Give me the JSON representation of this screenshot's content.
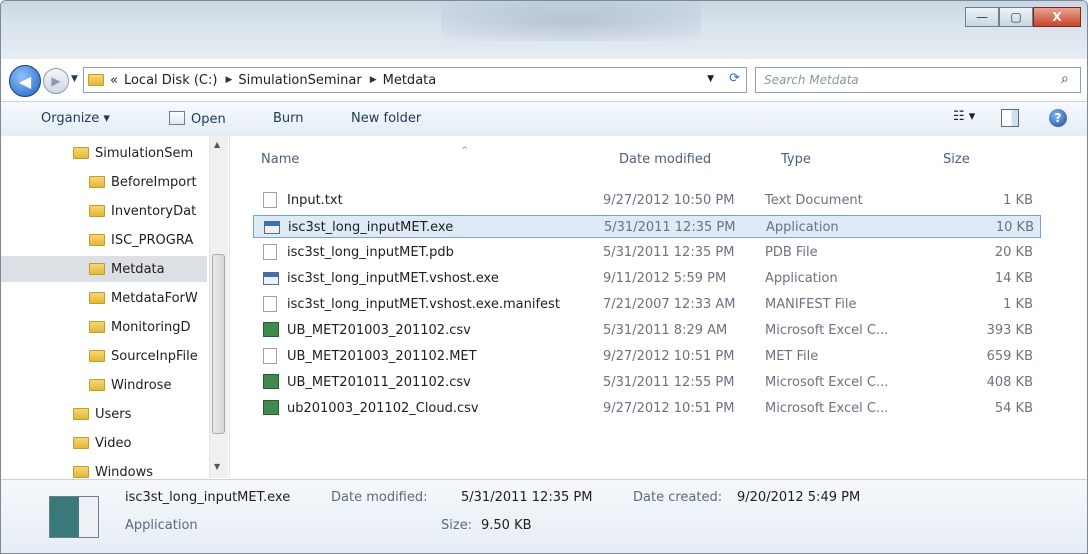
{
  "window": {
    "minimize_label": "—",
    "maximize_label": "▢",
    "close_label": "X"
  },
  "nav": {
    "back_label": "◀",
    "forward_label": "▶",
    "address_prefix": "«",
    "crumbs": [
      "Local Disk (C:)",
      "SimulationSeminar",
      "Metdata"
    ],
    "crumb_sep": "▶",
    "search_placeholder": "Search Metdata"
  },
  "toolbar": {
    "organize": "Organize ▾",
    "open": "Open",
    "burn": "Burn",
    "new_folder": "New folder"
  },
  "tree": {
    "items": [
      {
        "label": "SimulationSem",
        "indent": 0
      },
      {
        "label": "BeforeImport",
        "indent": 1
      },
      {
        "label": "InventoryDat",
        "indent": 1
      },
      {
        "label": "ISC_PROGRA",
        "indent": 1
      },
      {
        "label": "Metdata",
        "indent": 1,
        "selected": true
      },
      {
        "label": "MetdataForW",
        "indent": 1
      },
      {
        "label": "MonitoringD",
        "indent": 1
      },
      {
        "label": "SourceInpFile",
        "indent": 1
      },
      {
        "label": "Windrose",
        "indent": 1
      },
      {
        "label": "Users",
        "indent": 0
      },
      {
        "label": "Video",
        "indent": 0
      },
      {
        "label": "Windows",
        "indent": 0
      }
    ]
  },
  "columns": {
    "name": "Name",
    "date": "Date modified",
    "type": "Type",
    "size": "Size"
  },
  "files": [
    {
      "name": "Input.txt",
      "date": "9/27/2012 10:50 PM",
      "type": "Text Document",
      "size": "1 KB",
      "icon": "txt"
    },
    {
      "name": "isc3st_long_inputMET.exe",
      "date": "5/31/2011 12:35 PM",
      "type": "Application",
      "size": "10 KB",
      "icon": "exe",
      "selected": true
    },
    {
      "name": "isc3st_long_inputMET.pdb",
      "date": "5/31/2011 12:35 PM",
      "type": "PDB File",
      "size": "20 KB",
      "icon": "txt"
    },
    {
      "name": "isc3st_long_inputMET.vshost.exe",
      "date": "9/11/2012 5:59 PM",
      "type": "Application",
      "size": "14 KB",
      "icon": "exe"
    },
    {
      "name": "isc3st_long_inputMET.vshost.exe.manifest",
      "date": "7/21/2007 12:33 AM",
      "type": "MANIFEST File",
      "size": "1 KB",
      "icon": "txt"
    },
    {
      "name": "UB_MET201003_201102.csv",
      "date": "5/31/2011 8:29 AM",
      "type": "Microsoft Excel C...",
      "size": "393 KB",
      "icon": "xls"
    },
    {
      "name": "UB_MET201003_201102.MET",
      "date": "9/27/2012 10:51 PM",
      "type": "MET File",
      "size": "659 KB",
      "icon": "txt"
    },
    {
      "name": "UB_MET201011_201102.csv",
      "date": "5/31/2011 12:55 PM",
      "type": "Microsoft Excel C...",
      "size": "408 KB",
      "icon": "xls"
    },
    {
      "name": "ub201003_201102_Cloud.csv",
      "date": "9/27/2012 10:51 PM",
      "type": "Microsoft Excel C...",
      "size": "54 KB",
      "icon": "xls"
    }
  ],
  "status": {
    "filename": "isc3st_long_inputMET.exe",
    "date_modified_label": "Date modified:",
    "date_modified": "5/31/2011 12:35 PM",
    "date_created_label": "Date created:",
    "date_created": "9/20/2012 5:49 PM",
    "type": "Application",
    "size_label": "Size:",
    "size": "9.50 KB"
  }
}
